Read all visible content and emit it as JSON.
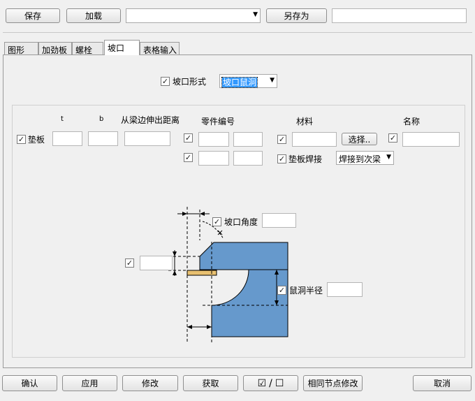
{
  "toolbar": {
    "save": "保存",
    "load": "加载",
    "preset_value": "",
    "save_as": "另存为",
    "save_as_name": ""
  },
  "tabs": [
    "图形",
    "加劲板",
    "螺栓",
    "坡口",
    "表格输入"
  ],
  "bevel": {
    "form_label": "坡口形式",
    "form_checked": true,
    "form_value": "坡口鼠洞"
  },
  "plate": {
    "col_t": "t",
    "col_b": "b",
    "col_ext": "从梁边伸出距离",
    "col_part": "零件编号",
    "col_material": "材料",
    "col_name": "名称",
    "row_label": "垫板",
    "row_checked": true,
    "t": "",
    "b": "",
    "ext": "",
    "part_checked_1": true,
    "part_prefix_1": "",
    "part_start_1": "",
    "part_checked_2": true,
    "part_prefix_2": "",
    "part_start_2": "",
    "material_checked": true,
    "material": "",
    "select_button": "选择..",
    "name_checked": true,
    "name": "",
    "weld_label": "垫板焊接",
    "weld_checked": true,
    "weld_value": "焊接到次梁"
  },
  "diagram": {
    "angle_label": "坡口角度",
    "angle_checked": true,
    "angle": "",
    "gap_checked": true,
    "gap": "",
    "radius_label": "鼠洞半径",
    "radius_checked": true,
    "radius": "",
    "steel_color": "#6699cc",
    "plate_color": "#e8c070"
  },
  "bottom": {
    "ok": "确认",
    "apply": "应用",
    "modify": "修改",
    "get": "获取",
    "toggle_on": "☑",
    "toggle_sep": "/",
    "toggle_off": "☐",
    "same_node": "相同节点修改",
    "cancel": "取消"
  }
}
